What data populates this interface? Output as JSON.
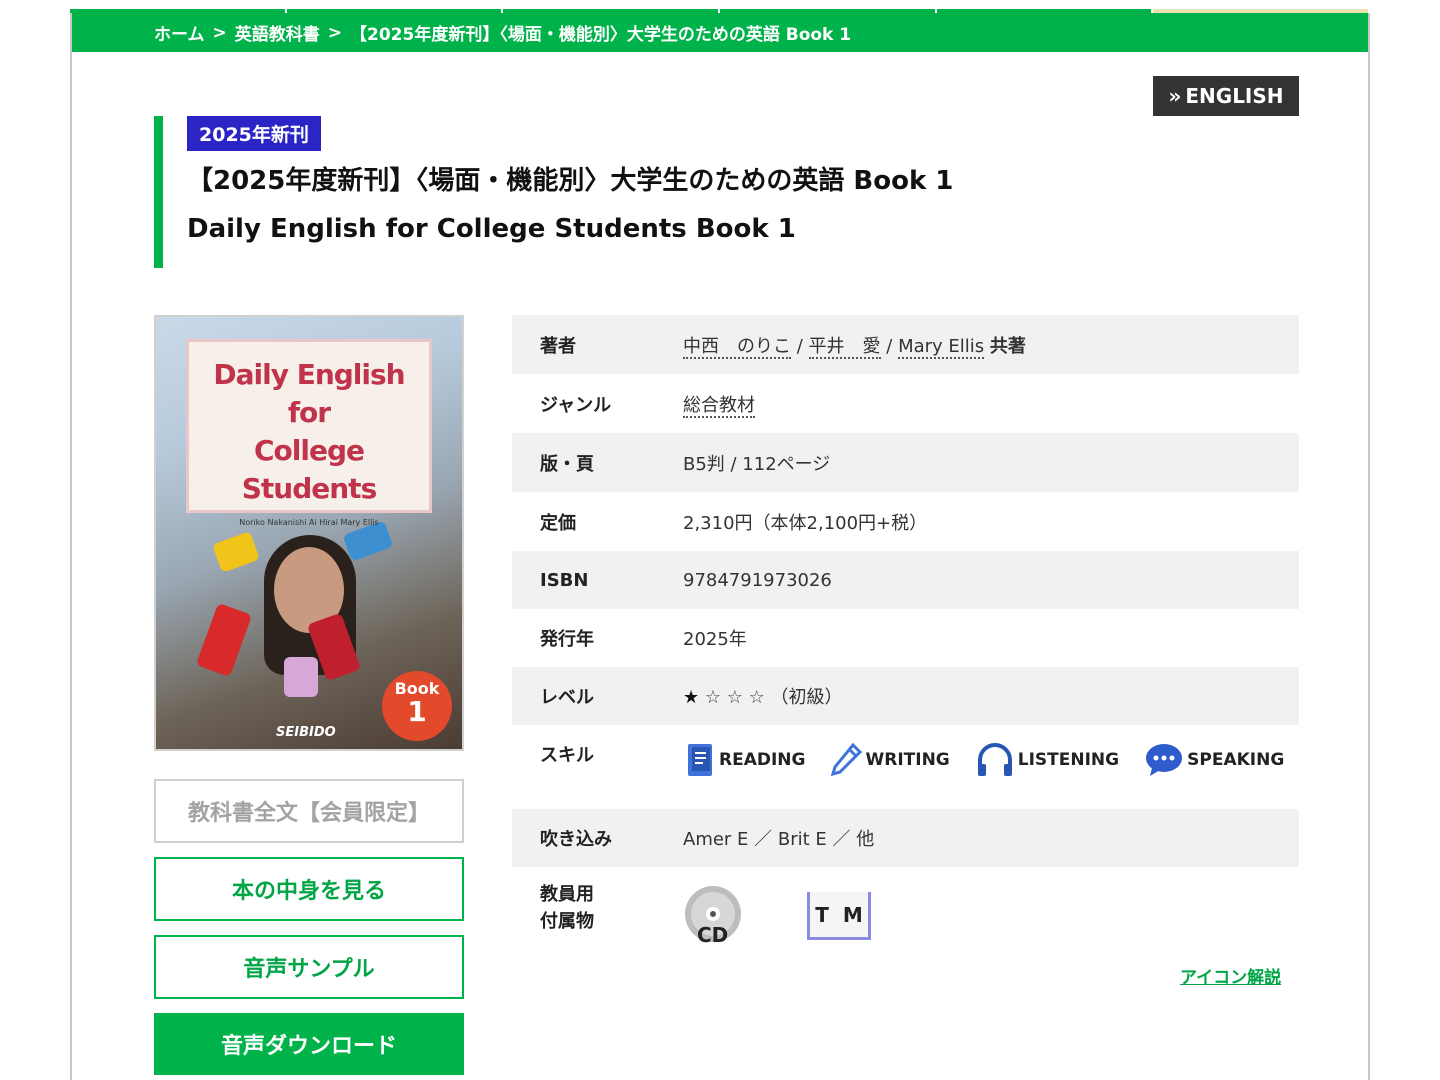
{
  "breadcrumb": {
    "home": "ホーム",
    "category": "英語教科書",
    "current": "【2025年度新刊】〈場面・機能別〉大学生のための英語 Book 1",
    "separator": ">"
  },
  "header": {
    "english_label": "ENGLISH",
    "english_arrows": "»"
  },
  "title": {
    "badge": "2025年新刊",
    "jp": "【2025年度新刊】〈場面・機能別〉大学生のための英語 Book 1",
    "en": "Daily English for College Students Book 1"
  },
  "cover": {
    "title_lines": [
      "Daily English",
      "for",
      "College Students"
    ],
    "authors": "Noriko Nakanishi   Ai Hirai   Mary Ellis",
    "book_label": "Book",
    "book_number": "1",
    "publisher": "SEIBIDO"
  },
  "buttons": {
    "members_only": "教科書全文【会員限定】",
    "inside": "本の中身を見る",
    "sample": "音声サンプル",
    "download": "音声ダウンロード"
  },
  "info": {
    "author_label": "著者",
    "authors": [
      "中西　のりこ",
      "平井　愛",
      "Mary Ellis"
    ],
    "author_sep": "/",
    "author_suffix": "共著",
    "genre_label": "ジャンル",
    "genre": "総合教材",
    "format_label": "版・頁",
    "format": "B5判 / 112ページ",
    "price_label": "定価",
    "price": "2,310円（本体2,100円+税）",
    "isbn_label": "ISBN",
    "isbn": "9784791973026",
    "year_label": "発行年",
    "year": "2025年",
    "level_label": "レベル",
    "level_stars_filled": "★",
    "level_stars_empty": "☆ ☆ ☆",
    "level_text": "（初級）",
    "level_value": 1,
    "level_max": 4,
    "skill_label": "スキル",
    "skills": [
      "READING",
      "WRITING",
      "LISTENING",
      "SPEAKING"
    ],
    "recording_label": "吹き込み",
    "recording": "Amer E ／ Brit E ／ 他",
    "teacher_label_1": "教員用",
    "teacher_label_2": "付属物",
    "cd_label": "CD",
    "tm_t": "T",
    "tm_m": "M",
    "icon_help": "アイコン解説"
  },
  "colors": {
    "accent_green": "#00b24a",
    "badge_blue": "#2a25c4",
    "english_btn": "#333333",
    "row_shade": "#f1f1f1"
  }
}
